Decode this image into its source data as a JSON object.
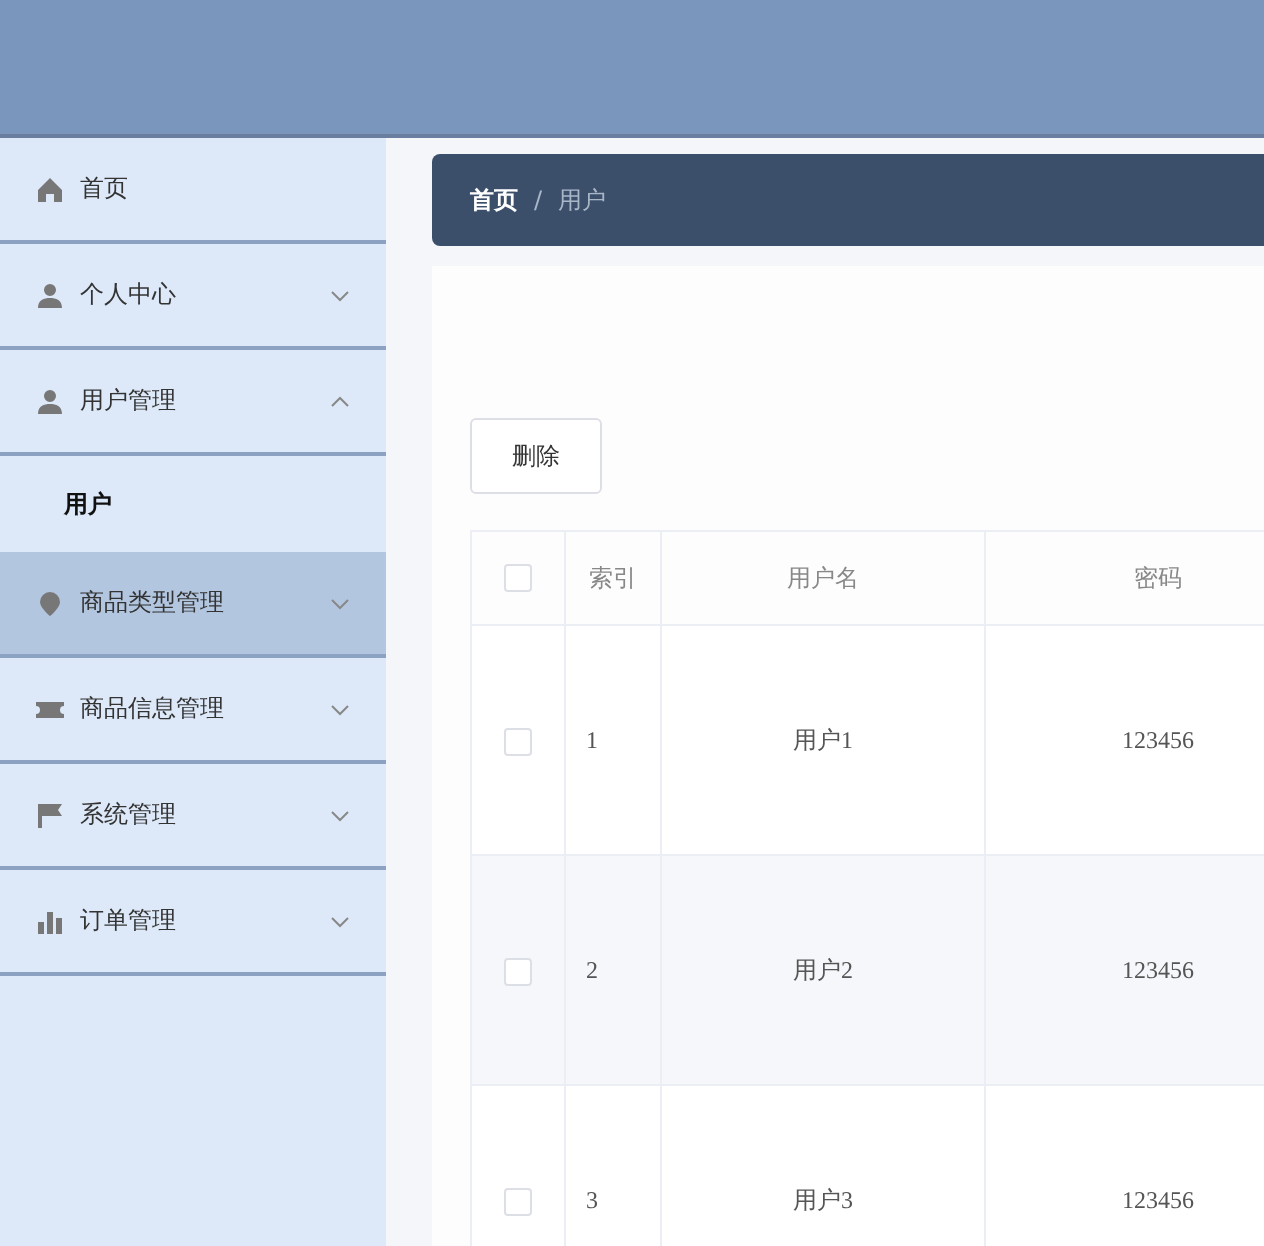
{
  "sidebar": {
    "items": [
      {
        "kind": "link",
        "label": "首页",
        "hovered": false
      },
      {
        "kind": "group",
        "label": "个人中心",
        "expanded": false,
        "hovered": false
      },
      {
        "kind": "group",
        "label": "用户管理",
        "expanded": true,
        "hovered": false,
        "children": [
          {
            "label": "用户",
            "selected": true
          }
        ]
      },
      {
        "kind": "group",
        "label": "商品类型管理",
        "expanded": false,
        "hovered": true
      },
      {
        "kind": "group",
        "label": "商品信息管理",
        "expanded": false,
        "hovered": false
      },
      {
        "kind": "group",
        "label": "系统管理",
        "expanded": false,
        "hovered": false
      },
      {
        "kind": "group",
        "label": "订单管理",
        "expanded": false,
        "hovered": false
      }
    ]
  },
  "breadcrumb": [
    "首页",
    "用户"
  ],
  "breadcrumb_separator": "/",
  "buttons": [
    "删除"
  ],
  "table": {
    "header_checked": false,
    "columns": [
      "索引",
      "用户名",
      "密码"
    ],
    "rows": [
      {
        "checked": false,
        "cells": [
          "1",
          "用户1",
          "123456"
        ]
      },
      {
        "checked": false,
        "cells": [
          "2",
          "用户2",
          "123456"
        ]
      },
      {
        "checked": false,
        "cells": [
          "3",
          "用户3",
          "123456"
        ]
      }
    ]
  }
}
